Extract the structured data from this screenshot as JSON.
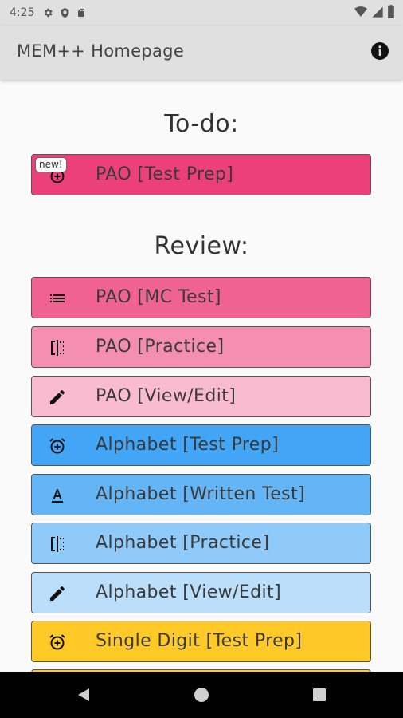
{
  "status_bar": {
    "time": "4:25",
    "left_icons": [
      "gear-icon",
      "shield-icon",
      "sd-card-icon"
    ],
    "right_icons": [
      "wifi-icon",
      "cell-signal-icon",
      "battery-icon"
    ]
  },
  "app_bar": {
    "title": "MEM++ Homepage",
    "info_icon": "info-icon"
  },
  "todo": {
    "heading": "To-do:",
    "items": [
      {
        "label": "PAO [Test Prep]",
        "icon": "alarm-add-icon",
        "badge": "new!",
        "color": "#ec407a"
      }
    ]
  },
  "review": {
    "heading": "Review:",
    "items": [
      {
        "label": "PAO [MC Test]",
        "icon": "list-icon",
        "color": "#f06292"
      },
      {
        "label": "PAO [Practice]",
        "icon": "flip-icon",
        "color": "#f48fb1"
      },
      {
        "label": "PAO [View/Edit]",
        "icon": "pencil-icon",
        "color": "#f8bbd0"
      },
      {
        "label": "Alphabet [Test Prep]",
        "icon": "alarm-add-icon",
        "color": "#42a5f5"
      },
      {
        "label": "Alphabet [Written Test]",
        "icon": "text-format-icon",
        "color": "#64b5f6"
      },
      {
        "label": "Alphabet [Practice]",
        "icon": "flip-icon",
        "color": "#90caf9"
      },
      {
        "label": "Alphabet [View/Edit]",
        "icon": "pencil-icon",
        "color": "#bbdefb"
      },
      {
        "label": "Single Digit [Test Prep]",
        "icon": "alarm-add-icon",
        "color": "#ffca28"
      }
    ]
  },
  "nav_bar": {
    "buttons": [
      "back-triangle-icon",
      "home-circle-icon",
      "recents-square-icon"
    ]
  }
}
